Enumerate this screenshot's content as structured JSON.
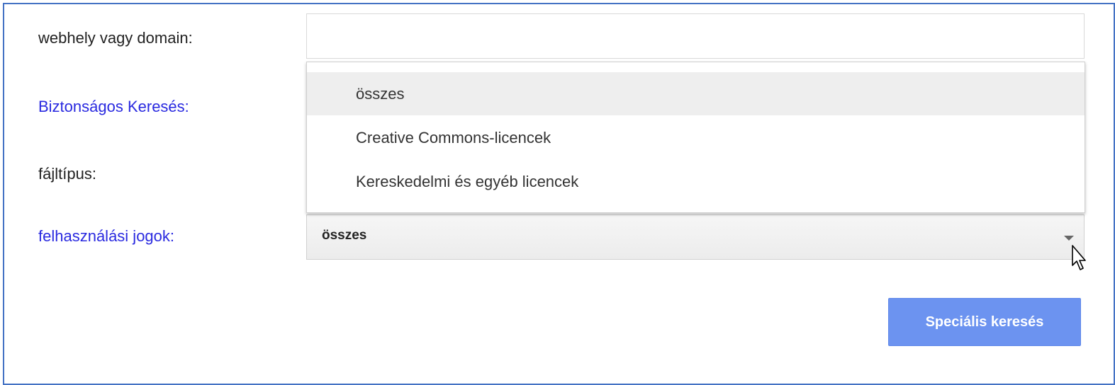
{
  "form": {
    "site_label": "webhely vagy domain:",
    "site_value": "",
    "safesearch_label": "Biztonságos Keresés:",
    "filetype_label": "fájltípus:",
    "rights_label": "felhasználási jogok:",
    "rights_selected": "összes"
  },
  "dropdown": {
    "options": [
      {
        "label": "összes",
        "selected": true
      },
      {
        "label": "Creative Commons-licencek",
        "selected": false
      },
      {
        "label": "Kereskedelmi és egyéb licencek",
        "selected": false
      }
    ]
  },
  "actions": {
    "search_label": "Speciális keresés"
  },
  "icons": {
    "select_caret": "triangle-down-icon",
    "cursor": "arrow-cursor-icon"
  },
  "colors": {
    "frame_border": "#4472c4",
    "link_label": "#2a2ae0",
    "button_bg": "#6c93f0",
    "selected_option_bg": "#eeeeee"
  }
}
